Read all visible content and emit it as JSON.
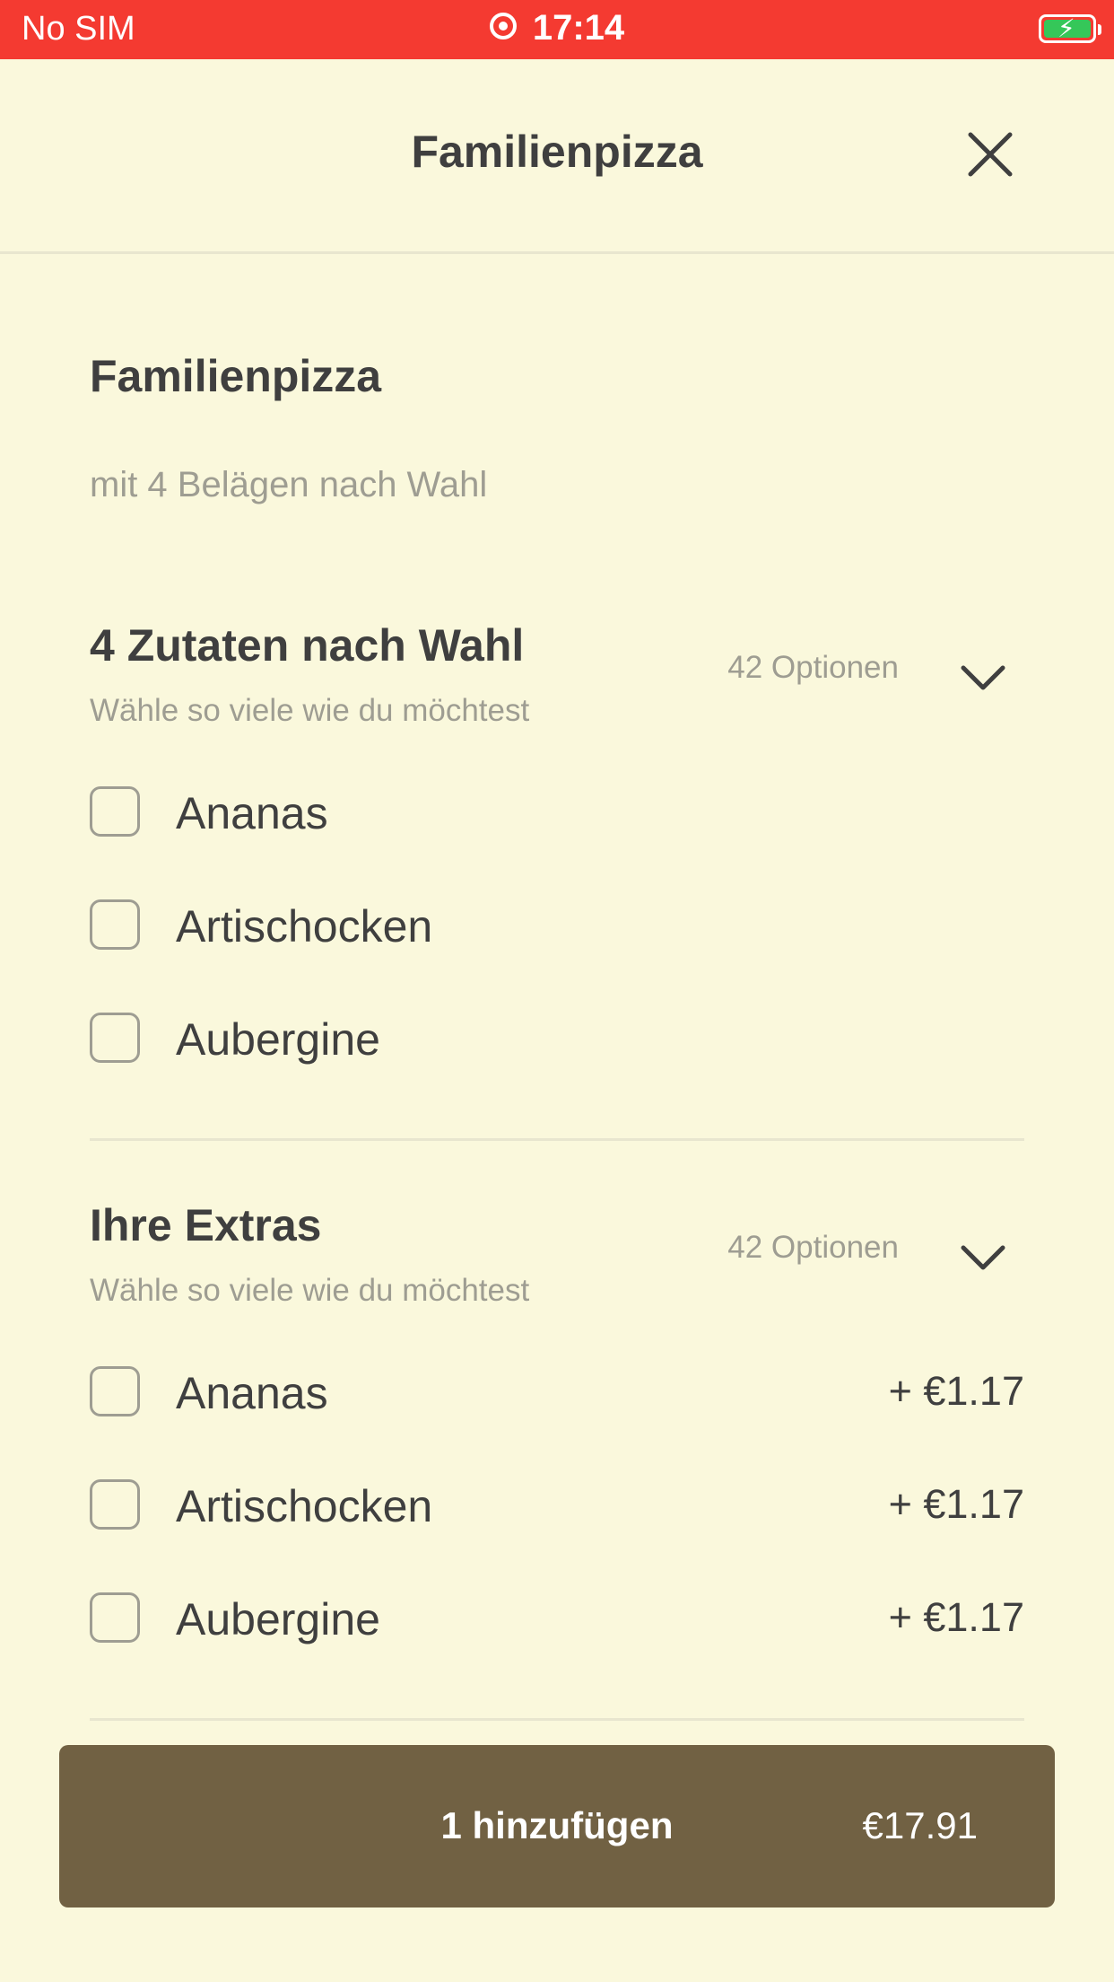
{
  "status_bar": {
    "carrier": "No SIM",
    "time": "17:14",
    "battery_color": "#35C759",
    "bar_color": "#F43A31"
  },
  "header": {
    "title": "Familienpizza",
    "close_icon": "close-icon"
  },
  "product": {
    "name": "Familienpizza",
    "description": "mit 4 Belägen nach Wahl"
  },
  "groups": [
    {
      "title": "4 Zutaten nach Wahl",
      "hint": "Wähle so viele wie du möchtest",
      "count": "42 Optionen",
      "options": [
        {
          "label": "Ananas",
          "checked": false
        },
        {
          "label": "Artischocken",
          "checked": false
        },
        {
          "label": "Aubergine",
          "checked": false
        }
      ]
    },
    {
      "title": "Ihre Extras",
      "hint": "Wähle so viele wie du möchtest",
      "count": "42 Optionen",
      "options": [
        {
          "label": "Ananas",
          "price": "+ €1.17",
          "checked": false
        },
        {
          "label": "Artischocken",
          "price": "+ €1.17",
          "checked": false
        },
        {
          "label": "Aubergine",
          "price": "+ €1.17",
          "checked": false
        }
      ]
    }
  ],
  "add_button": {
    "label": "1 hinzufügen",
    "price": "€17.91",
    "color": "#716143"
  },
  "colors": {
    "background": "#FAF8DC",
    "text": "#3F3F3F",
    "muted": "#9E9D92"
  }
}
